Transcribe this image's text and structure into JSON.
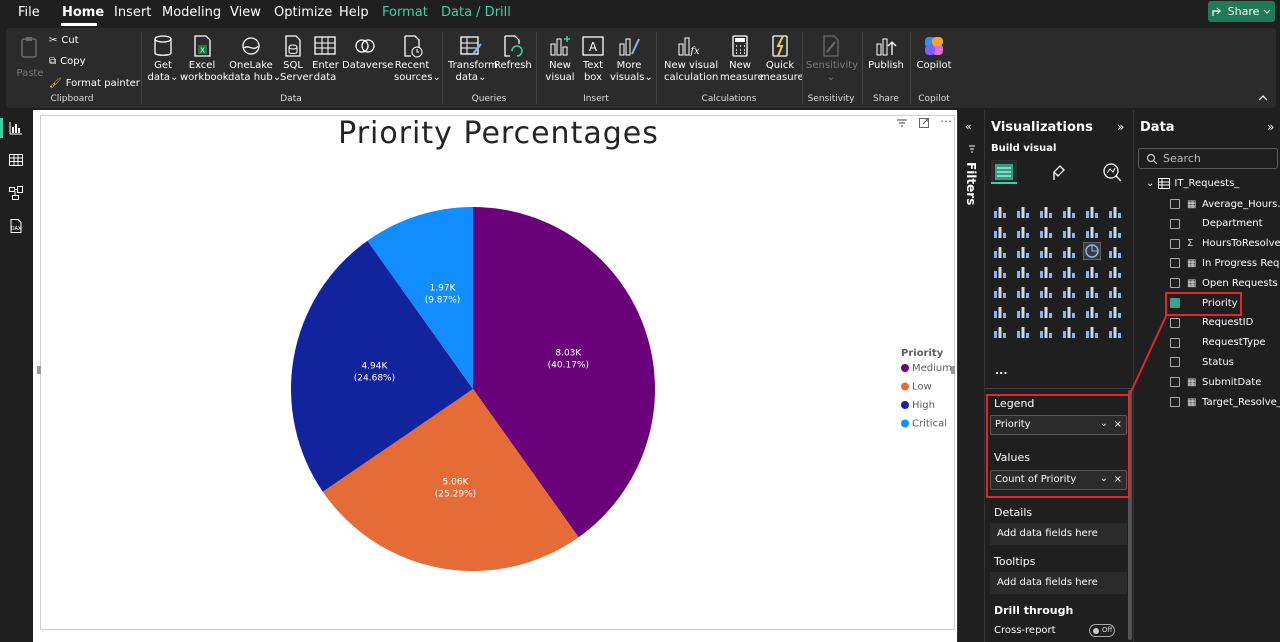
{
  "menu": {
    "items": [
      "File",
      "Home",
      "Insert",
      "Modeling",
      "View",
      "Optimize",
      "Help",
      "Format",
      "Data / Drill"
    ],
    "active": "Home",
    "context_tabs": [
      "Format",
      "Data / Drill"
    ],
    "share_label": "Share"
  },
  "ribbon": {
    "clipboard": {
      "paste": "Paste",
      "cut": "Cut",
      "copy": "Copy",
      "format_painter": "Format painter",
      "group": "Clipboard"
    },
    "data": {
      "get_data_1": "Get",
      "get_data_2": "data",
      "excel_1": "Excel",
      "excel_2": "workbook",
      "onelake_1": "OneLake",
      "onelake_2": "data hub",
      "sql_1": "SQL",
      "sql_2": "Server",
      "enter_1": "Enter",
      "enter_2": "data",
      "dataverse": "Dataverse",
      "recent_1": "Recent",
      "recent_2": "sources",
      "group": "Data"
    },
    "queries": {
      "transform_1": "Transform",
      "transform_2": "data",
      "refresh": "Refresh",
      "group": "Queries"
    },
    "insert": {
      "new_visual_1": "New",
      "new_visual_2": "visual",
      "textbox_1": "Text",
      "textbox_2": "box",
      "more_1": "More",
      "more_2": "visuals",
      "group": "Insert"
    },
    "calculations": {
      "new_calc_1": "New visual",
      "new_calc_2": "calculation",
      "new_measure_1": "New",
      "new_measure_2": "measure",
      "quick_1": "Quick",
      "quick_2": "measure",
      "group": "Calculations"
    },
    "sensitivity": {
      "label": "Sensitivity",
      "group": "Sensitivity"
    },
    "share": {
      "publish": "Publish",
      "group": "Share"
    },
    "copilot": {
      "label": "Copilot",
      "group": "Copilot"
    }
  },
  "filters_label": "Filters",
  "visualizations": {
    "title": "Visualizations",
    "build_visual": "Build visual",
    "more": "...",
    "legend_label": "Legend",
    "legend_field": "Priority",
    "values_label": "Values",
    "values_field": "Count of Priority",
    "details_label": "Details",
    "details_placeholder": "Add data fields here",
    "tooltips_label": "Tooltips",
    "tooltips_placeholder": "Add data fields here",
    "drill_through": "Drill through",
    "cross_report": "Cross-report",
    "toggle_off": "Off"
  },
  "data_pane": {
    "title": "Data",
    "search_placeholder": "Search",
    "table_name": "IT_Requests_",
    "fields": [
      {
        "label": "Average_Hours...",
        "type": "calc",
        "checked": false
      },
      {
        "label": "Department",
        "type": "",
        "checked": false
      },
      {
        "label": "HoursToResolve",
        "type": "sum",
        "checked": false
      },
      {
        "label": "In Progress Req...",
        "type": "calc",
        "checked": false
      },
      {
        "label": "Open Requests",
        "type": "calc",
        "checked": false
      },
      {
        "label": "Priority",
        "type": "",
        "checked": true
      },
      {
        "label": "RequestID",
        "type": "",
        "checked": false
      },
      {
        "label": "RequestType",
        "type": "",
        "checked": false
      },
      {
        "label": "Status",
        "type": "",
        "checked": false
      },
      {
        "label": "SubmitDate",
        "type": "calendar",
        "checked": false
      },
      {
        "label": "Target_Resolve_...",
        "type": "calendar",
        "checked": false
      }
    ]
  },
  "chart_data": {
    "type": "pie",
    "title": "Priority Percentages",
    "legend_title": "Priority",
    "legend_position": "right",
    "categories": [
      "Medium",
      "Low",
      "High",
      "Critical"
    ],
    "values": [
      8030,
      5060,
      4940,
      1970
    ],
    "value_labels": [
      "8.03K",
      "5.06K",
      "4.94K",
      "1.97K"
    ],
    "percent_labels": [
      "(40.17%)",
      "(25.29%)",
      "(24.68%)",
      "(9.87%)"
    ],
    "colors": [
      "#6b007b",
      "#e66c37",
      "#12239e",
      "#118dff"
    ]
  }
}
